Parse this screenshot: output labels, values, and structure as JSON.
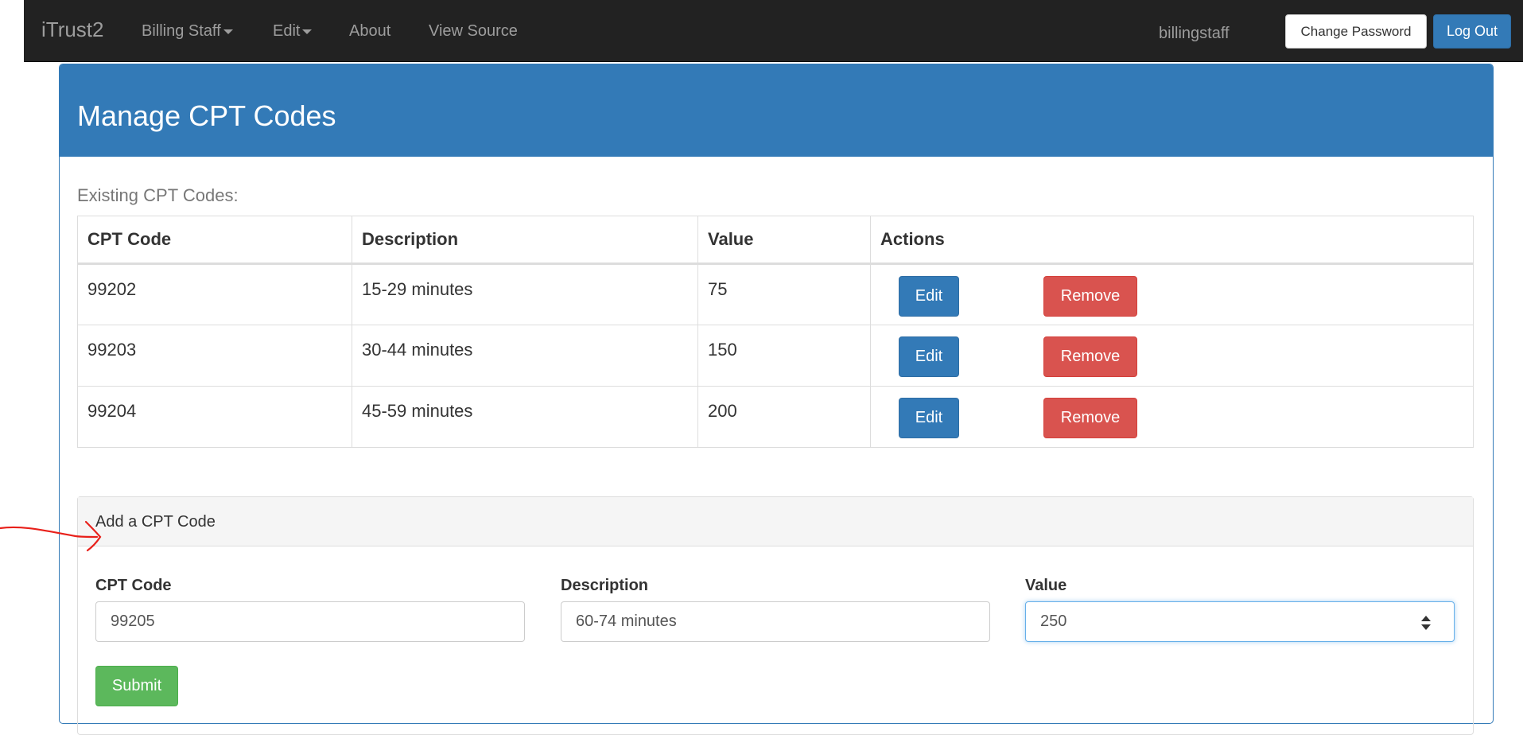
{
  "navbar": {
    "brand": "iTrust2",
    "items": [
      {
        "label": "Billing Staff",
        "dropdown": true
      },
      {
        "label": "Edit",
        "dropdown": true
      },
      {
        "label": "About",
        "dropdown": false
      },
      {
        "label": "View Source",
        "dropdown": false
      }
    ],
    "username": "billingstaff",
    "change_password_label": "Change Password",
    "logout_label": "Log Out"
  },
  "page": {
    "title": "Manage CPT Codes",
    "existing_label": "Existing CPT Codes:"
  },
  "table": {
    "headers": [
      "CPT Code",
      "Description",
      "Value",
      "Actions"
    ],
    "rows": [
      {
        "code": "99202",
        "description": "15-29 minutes",
        "value": "75"
      },
      {
        "code": "99203",
        "description": "30-44 minutes",
        "value": "150"
      },
      {
        "code": "99204",
        "description": "45-59 minutes",
        "value": "200"
      }
    ],
    "edit_label": "Edit",
    "remove_label": "Remove"
  },
  "add_form": {
    "title": "Add a CPT Code",
    "code_label": "CPT Code",
    "code_value": "99205",
    "description_label": "Description",
    "description_value": "60-74 minutes",
    "value_label": "Value",
    "value_value": "250",
    "submit_label": "Submit"
  },
  "colors": {
    "navbar_bg": "#222222",
    "primary": "#337ab7",
    "danger": "#d9534f",
    "success": "#5cb85c",
    "annotation": "#e8201a"
  }
}
